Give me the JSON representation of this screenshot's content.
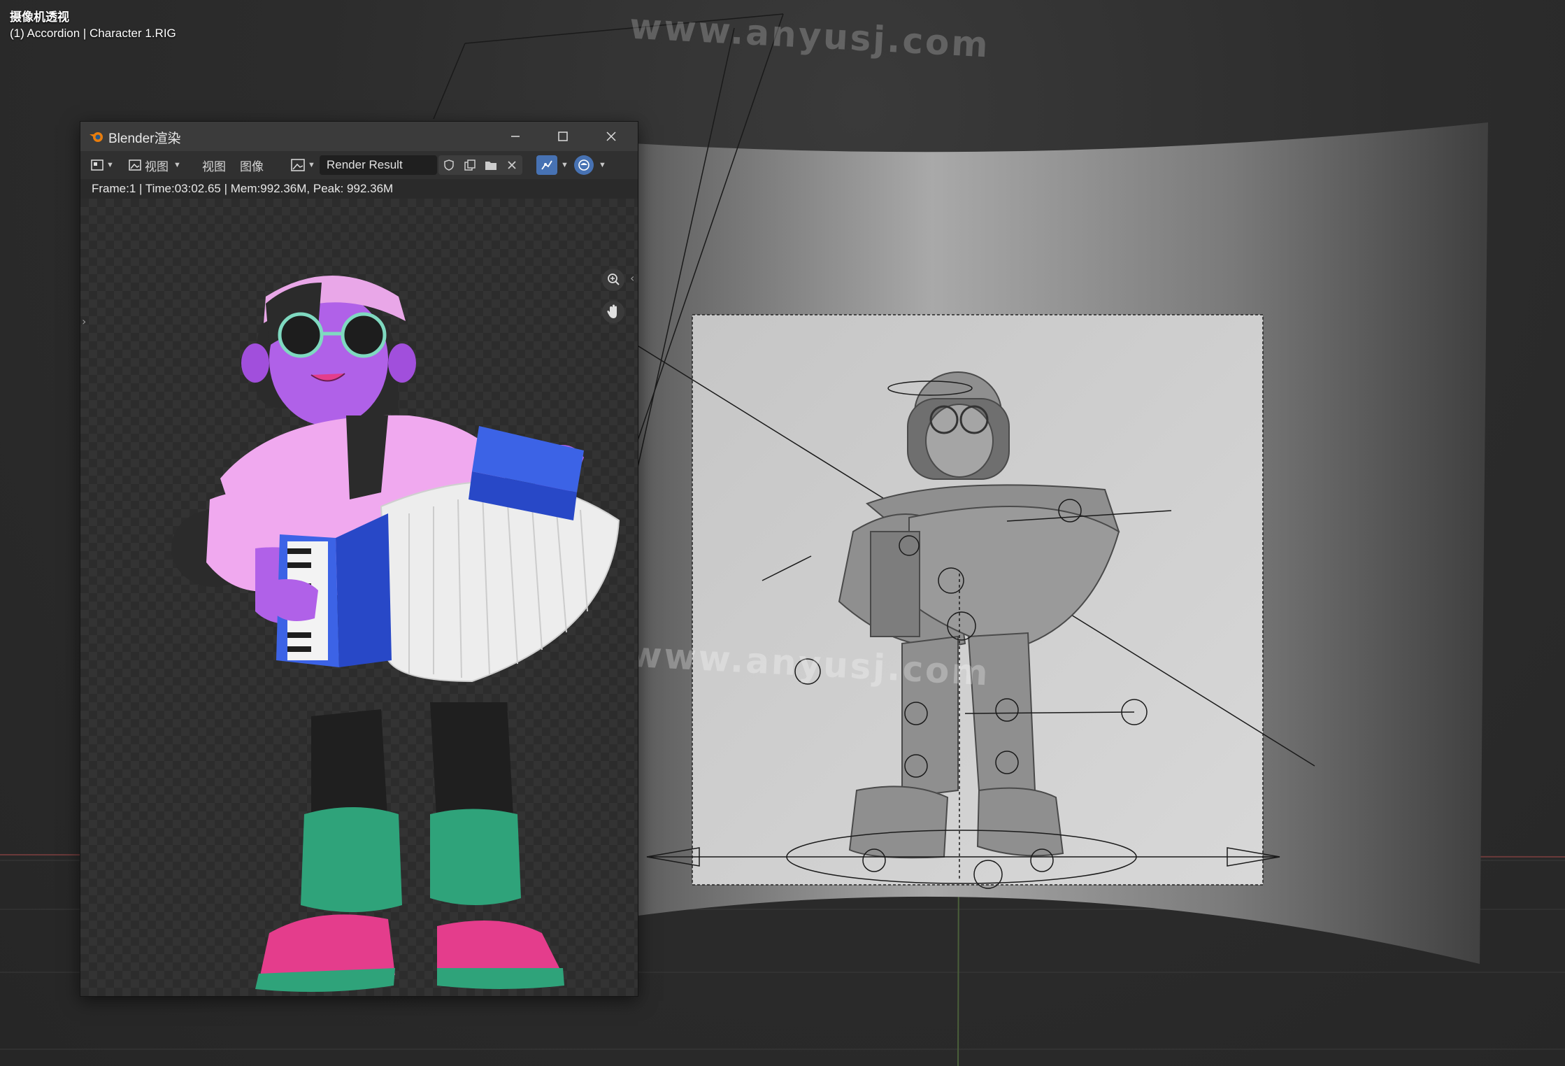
{
  "viewport": {
    "title": "摄像机透视",
    "object_info": "(1) Accordion | Character 1.RIG",
    "watermark": "www.anyusj.com"
  },
  "render_window": {
    "title": "Blender渲染",
    "toolbar": {
      "view_menu_1": "视图",
      "view_menu_2": "视图",
      "image_menu": "图像",
      "image_name": "Render Result"
    },
    "info": "Frame:1 | Time:03:02.65 | Mem:992.36M, Peak: 992.36M"
  },
  "icons": [
    "blender-logo-icon",
    "minimize-icon",
    "maximize-icon",
    "close-icon",
    "editor-type-icon",
    "image-icon",
    "shield-icon",
    "copy-icon",
    "folder-icon",
    "x-icon",
    "scopes-icon",
    "display-channels-icon",
    "zoom-icon",
    "hand-icon"
  ],
  "colors": {
    "accent_blue": "#4772b3",
    "skin_purple": "#b061e8",
    "hair_pink": "#e9a7e8",
    "pants_green": "#2fa37a",
    "shoe_pink": "#e43d8c",
    "accordion_blue": "#3c63e6"
  }
}
